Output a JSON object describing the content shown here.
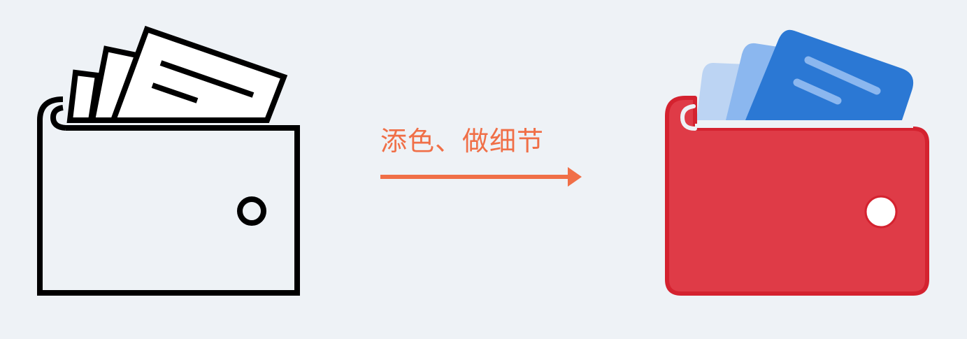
{
  "caption": "添色、做细节",
  "colors": {
    "background": "#eef2f6",
    "outline": "#000000",
    "accent_arrow": "#f06f47",
    "wallet_body": "#df3b47",
    "wallet_rim": "#d4222f",
    "card_front": "#2b78d4",
    "card_middle": "#8bb7ef",
    "card_back": "#bcd4f3",
    "clasp": "#ffffff"
  },
  "icons": {
    "before": "wallet-outline-icon",
    "after": "wallet-colored-icon",
    "transition": "arrow-right-icon"
  }
}
